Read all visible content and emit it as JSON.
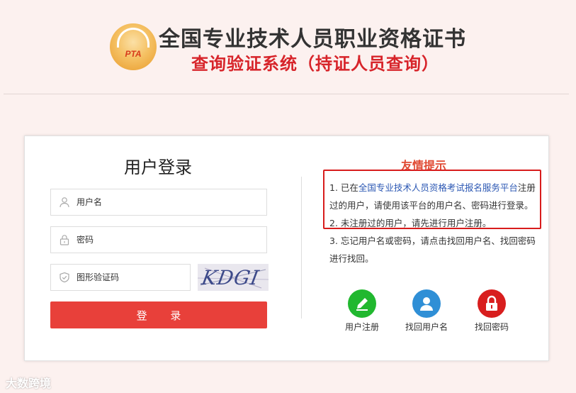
{
  "header": {
    "logo_text": "PTA",
    "title": "全国专业技术人员职业资格证书",
    "subtitle": "查询验证系统（持证人员查询）"
  },
  "login": {
    "title": "用户登录",
    "username_placeholder": "用户名",
    "password_placeholder": "密码",
    "captcha_placeholder": "图形验证码",
    "captcha_text": "KDGI",
    "submit_label": "登 录"
  },
  "tips": {
    "title": "友情提示",
    "item1_prefix": "1. 已在",
    "item1_link": "全国专业技术人员资格考试报名服务平台",
    "item1_suffix": "注册过的用户，请使用该平台的用户名、密码进行登录。",
    "item2": "2. 未注册过的用户，请先进行用户注册。",
    "item3": "3. 忘记用户名或密码，请点击找回用户名、找回密码进行找回。"
  },
  "actions": [
    {
      "label": "用户注册",
      "icon": "pencil-icon",
      "color": "#21b82f"
    },
    {
      "label": "找回用户名",
      "icon": "user-icon",
      "color": "#2f8fd6"
    },
    {
      "label": "找回密码",
      "icon": "lock-icon",
      "color": "#d81e1e"
    }
  ],
  "watermark": "大数跨境",
  "colors": {
    "accent": "#e8403a",
    "subtitle": "#d7242a",
    "tip_border": "#d81c1c",
    "link": "#2b57b3",
    "background": "#fcf1ef"
  }
}
